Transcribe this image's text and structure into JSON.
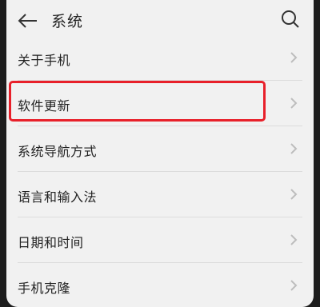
{
  "header": {
    "title": "系统",
    "back_icon": "back-arrow-icon",
    "search_icon": "search-icon"
  },
  "list": {
    "items": [
      {
        "label": "关于手机"
      },
      {
        "label": "软件更新"
      },
      {
        "label": "系统导航方式"
      },
      {
        "label": "语言和输入法"
      },
      {
        "label": "日期和时间"
      },
      {
        "label": "手机克隆"
      }
    ]
  },
  "colors": {
    "background": "#f1f1f1",
    "highlight": "#e8202a",
    "text": "#222222",
    "chevron": "#bdbdbd"
  }
}
